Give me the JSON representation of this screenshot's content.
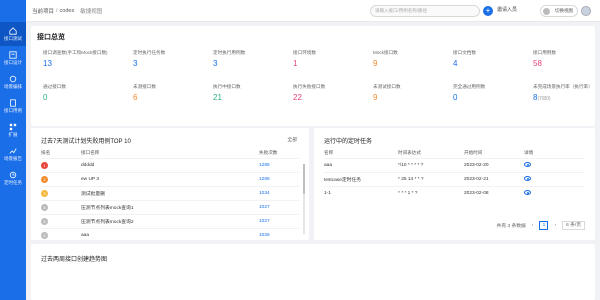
{
  "sidebar": {
    "items": [
      {
        "label": "接口测试",
        "icon": "home-icon",
        "active": true
      },
      {
        "label": "接口设计",
        "icon": "design-icon"
      },
      {
        "label": "场景编排",
        "icon": "scene-icon"
      },
      {
        "label": "接口用例",
        "icon": "case-icon"
      },
      {
        "label": "扩展",
        "icon": "extend-icon"
      },
      {
        "label": "场景报告",
        "icon": "report-icon"
      },
      {
        "label": "定时任务",
        "icon": "timer-icon"
      }
    ]
  },
  "topbar": {
    "project": "当前项目",
    "sep": "/",
    "repo": "codes",
    "view": "敏捷视图",
    "search_placeholder": "请输入接口/用例名称/路径",
    "invite": "邀请入员",
    "switch": "切换视图"
  },
  "overview": {
    "title": "接口总览",
    "stats": [
      {
        "label": "接口调查数(手工和Mock接口数)",
        "value": "13",
        "color": "#1a6fe8"
      },
      {
        "label": "定时执行任务数",
        "value": "3",
        "color": "#1a6fe8"
      },
      {
        "label": "定时执行用例数",
        "value": "3",
        "color": "#1a6fe8"
      },
      {
        "label": "接口环境数",
        "value": "1",
        "color": "#e8447a"
      },
      {
        "label": "Mock接口数",
        "value": "9",
        "color": "#f08c2e"
      },
      {
        "label": "接口文档数",
        "value": "4",
        "color": "#1a6fe8"
      },
      {
        "label": "接口用例数",
        "value": "58",
        "color": "#e8447a"
      },
      {
        "label": "通过接口数",
        "value": "0",
        "color": "#2fb17a"
      },
      {
        "label": "未测接口数",
        "value": "6",
        "color": "#f08c2e"
      },
      {
        "label": "执行中接口数",
        "value": "21",
        "color": "#2fb17a"
      },
      {
        "label": "执行失败接口数",
        "value": "22",
        "color": "#e8447a"
      },
      {
        "label": "未测试接口数",
        "value": "9",
        "color": "#f08c2e"
      },
      {
        "label": "完全通过用例数",
        "value": "0",
        "color": "#1a6fe8"
      },
      {
        "label": "未完成场景执行率（执行率）",
        "value": "8",
        "sub": "(7/80)",
        "color": "#1a6fe8"
      }
    ]
  },
  "top10": {
    "title": "过去7天测试计划失败用例TOP 10",
    "filter": "全部",
    "col_rank": "排名",
    "col_name": "接口名称",
    "col_count": "失败次数",
    "rows": [
      {
        "rank": "1",
        "name": "ddddd",
        "count": "1285",
        "color": "#e8443a"
      },
      {
        "rank": "2",
        "name": "ew UP 3",
        "count": "1285",
        "color": "#f08c2e"
      },
      {
        "rank": "3",
        "name": "测试批量删",
        "count": "1034",
        "color": "#f5b83b"
      },
      {
        "rank": "4",
        "name": "压测节点列表mock查询1",
        "count": "1027",
        "color": "#bbbbbb"
      },
      {
        "rank": "5",
        "name": "压测节点列表mock查询2",
        "count": "1027",
        "color": "#bbbbbb"
      },
      {
        "rank": "6",
        "name": "aaa",
        "count": "1026",
        "color": "#bbbbbb"
      }
    ]
  },
  "tasks": {
    "title": "运行中的定时任务",
    "col_name": "名称",
    "col_cron": "时间表达式",
    "col_start": "开始时间",
    "col_detail": "详情",
    "rows": [
      {
        "name": "aaa",
        "cron": "*/10 * * * * ?",
        "start": "2023-02-20"
      },
      {
        "name": "testcase定时任务",
        "cron": "* 25 14 * * ?",
        "start": "2023-02-21"
      },
      {
        "name": "1-1",
        "cron": "* * * 1 * ?",
        "start": "2023-02-08"
      }
    ],
    "pager": {
      "total": "共有 3 条数据",
      "page": "1",
      "size": "6 条/页"
    }
  },
  "bottom": {
    "title": "过去两周接口创建趋势图"
  }
}
